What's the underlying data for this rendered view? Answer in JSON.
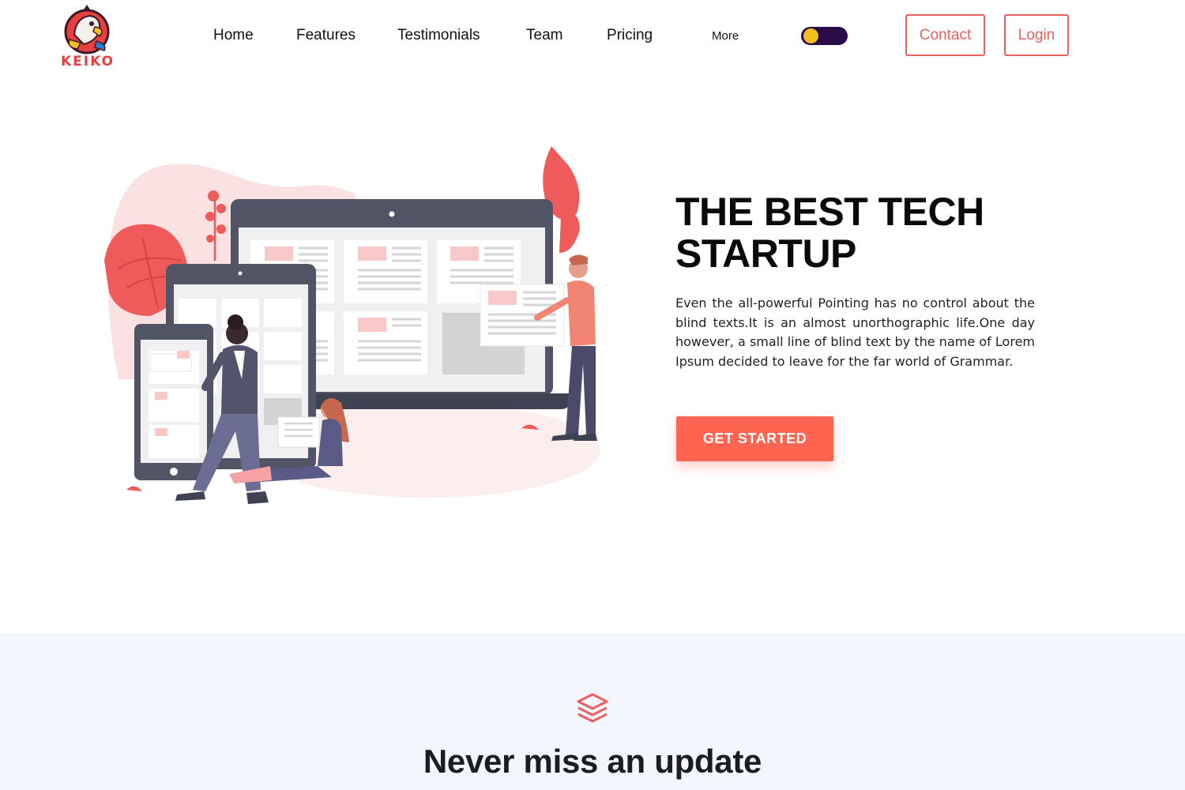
{
  "brand": {
    "name": "KEIKO",
    "accent": "#e9605f",
    "cta_color": "#fe6550"
  },
  "nav": {
    "links": [
      "Home",
      "Features",
      "Testimonials",
      "Team",
      "Pricing"
    ],
    "more": "More",
    "theme_toggle": {
      "knob_color": "#f2bf1c",
      "track_color": "#2a0b4a"
    },
    "contact": "Contact",
    "login": "Login"
  },
  "hero": {
    "title_line1": "THE BEST TECH",
    "title_line2": "STARTUP",
    "text": "Even the all-powerful Pointing has no control about the blind texts.It is an almost unorthographic life.One day however, a small line of blind text by the name of Lorem Ipsum decided to leave for the far world of Grammar.",
    "cta": "GET STARTED"
  },
  "update_section": {
    "icon": "layers-icon",
    "title": "Never miss an update"
  }
}
